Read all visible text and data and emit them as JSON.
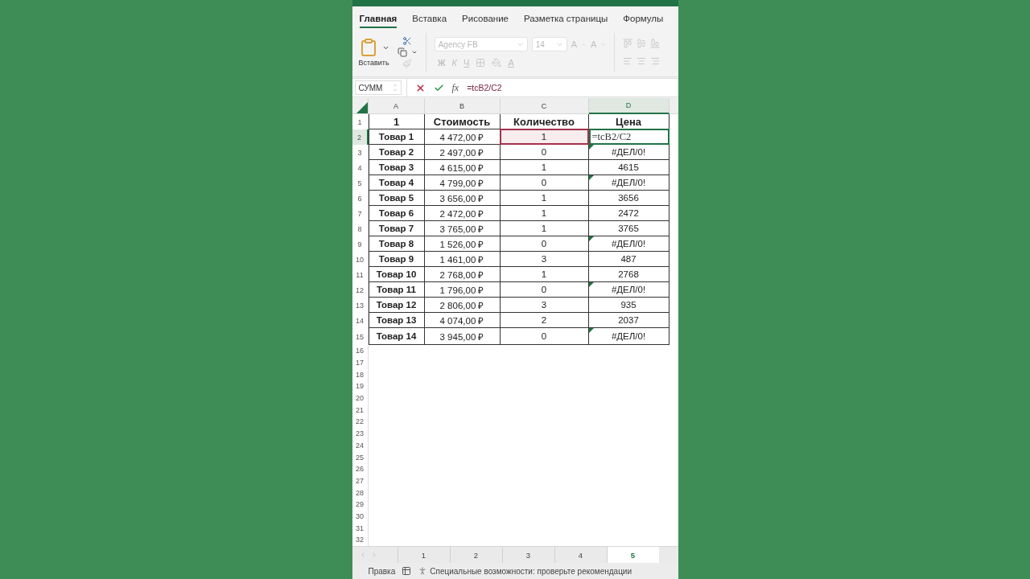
{
  "ribbon_tabs": [
    {
      "label": "Главная",
      "selected": true
    },
    {
      "label": "Вставка",
      "selected": false
    },
    {
      "label": "Рисование",
      "selected": false
    },
    {
      "label": "Разметка страницы",
      "selected": false
    },
    {
      "label": "Формулы",
      "selected": false
    }
  ],
  "ribbon": {
    "paste_label": "Вставить",
    "font_name": "Agency FB",
    "font_size": "14",
    "grow_label": "A",
    "shrink_label": "A",
    "format_buttons": [
      "Ж",
      "К",
      "Ч"
    ],
    "font_color_label": "A",
    "disabled": true
  },
  "formula_bar": {
    "name_box": "СУММ",
    "function_label": "fx",
    "formula": "=tcB2/C2"
  },
  "columns": [
    {
      "label": "A",
      "selected": false
    },
    {
      "label": "B",
      "selected": false
    },
    {
      "label": "C",
      "selected": false
    },
    {
      "label": "D",
      "selected": true
    }
  ],
  "header_row": {
    "number": "1",
    "a": "1",
    "b": "Стоимость",
    "c": "Количество",
    "d": "Цена"
  },
  "rows": [
    {
      "number": "2",
      "a": "Товар 1",
      "b": "4 472,00 ₽",
      "c": "1",
      "d": "=tcB2/C2",
      "selected": true,
      "referenced": true,
      "editing": true,
      "error_flag": false
    },
    {
      "number": "3",
      "a": "Товар 2",
      "b": "2 497,00 ₽",
      "c": "0",
      "d": "#ДЕЛ/0!",
      "selected": false,
      "referenced": false,
      "editing": false,
      "error_flag": true
    },
    {
      "number": "4",
      "a": "Товар 3",
      "b": "4 615,00 ₽",
      "c": "1",
      "d": "4615",
      "selected": false,
      "referenced": false,
      "editing": false,
      "error_flag": false
    },
    {
      "number": "5",
      "a": "Товар 4",
      "b": "4 799,00 ₽",
      "c": "0",
      "d": "#ДЕЛ/0!",
      "selected": false,
      "referenced": false,
      "editing": false,
      "error_flag": true
    },
    {
      "number": "6",
      "a": "Товар 5",
      "b": "3 656,00 ₽",
      "c": "1",
      "d": "3656",
      "selected": false,
      "referenced": false,
      "editing": false,
      "error_flag": false
    },
    {
      "number": "7",
      "a": "Товар 6",
      "b": "2 472,00 ₽",
      "c": "1",
      "d": "2472",
      "selected": false,
      "referenced": false,
      "editing": false,
      "error_flag": false
    },
    {
      "number": "8",
      "a": "Товар 7",
      "b": "3 765,00 ₽",
      "c": "1",
      "d": "3765",
      "selected": false,
      "referenced": false,
      "editing": false,
      "error_flag": false
    },
    {
      "number": "9",
      "a": "Товар 8",
      "b": "1 526,00 ₽",
      "c": "0",
      "d": "#ДЕЛ/0!",
      "selected": false,
      "referenced": false,
      "editing": false,
      "error_flag": true
    },
    {
      "number": "10",
      "a": "Товар 9",
      "b": "1 461,00 ₽",
      "c": "3",
      "d": "487",
      "selected": false,
      "referenced": false,
      "editing": false,
      "error_flag": false
    },
    {
      "number": "11",
      "a": "Товар 10",
      "b": "2 768,00 ₽",
      "c": "1",
      "d": "2768",
      "selected": false,
      "referenced": false,
      "editing": false,
      "error_flag": false
    },
    {
      "number": "12",
      "a": "Товар 11",
      "b": "1 796,00 ₽",
      "c": "0",
      "d": "#ДЕЛ/0!",
      "selected": false,
      "referenced": false,
      "editing": false,
      "error_flag": true
    },
    {
      "number": "13",
      "a": "Товар 12",
      "b": "2 806,00 ₽",
      "c": "3",
      "d": "935",
      "selected": false,
      "referenced": false,
      "editing": false,
      "error_flag": false
    },
    {
      "number": "14",
      "a": "Товар 13",
      "b": "4 074,00 ₽",
      "c": "2",
      "d": "2037",
      "selected": false,
      "referenced": false,
      "editing": false,
      "error_flag": false
    },
    {
      "number": "15",
      "a": "Товар 14",
      "b": "3 945,00 ₽",
      "c": "0",
      "d": "#ДЕЛ/0!",
      "selected": false,
      "referenced": false,
      "editing": false,
      "error_flag": true
    }
  ],
  "empty_row_numbers": [
    "16",
    "17",
    "18",
    "19",
    "20",
    "21",
    "22",
    "23",
    "24",
    "25",
    "26",
    "27",
    "28",
    "29",
    "30",
    "31",
    "32"
  ],
  "sheet_tabs": [
    {
      "label": "1",
      "selected": false
    },
    {
      "label": "2",
      "selected": false
    },
    {
      "label": "3",
      "selected": false
    },
    {
      "label": "4",
      "selected": false
    },
    {
      "label": "5",
      "selected": true
    }
  ],
  "status_bar": {
    "mode": "Правка",
    "accessibility": "Специальные возможности: проверьте рекомендации"
  }
}
